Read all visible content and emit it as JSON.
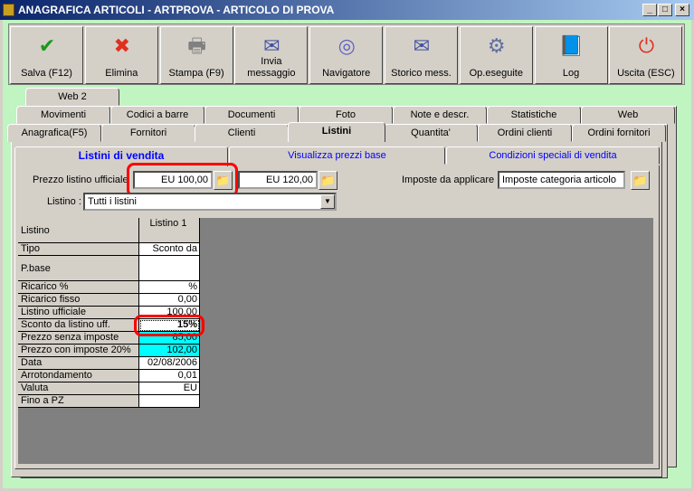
{
  "window": {
    "title": "ANAGRAFICA ARTICOLI - ARTPROVA - ARTICOLO DI PROVA",
    "minimize": "_",
    "maximize": "□",
    "close": "×"
  },
  "toolbar": [
    {
      "label": "Salva (F12)",
      "icon": "check-icon",
      "glyph": "✔",
      "color": "#1a9a1a"
    },
    {
      "label": "Elimina",
      "icon": "delete-x-icon",
      "glyph": "✖",
      "color": "#e03020"
    },
    {
      "label": "Stampa (F9)",
      "icon": "printer-icon",
      "glyph": "🖶",
      "color": "#808080"
    },
    {
      "label": "Invia messaggio",
      "icon": "envelope-pen-icon",
      "glyph": "✉",
      "color": "#4050a0"
    },
    {
      "label": "Navigatore",
      "icon": "compass-icon",
      "glyph": "◎",
      "color": "#6060c0"
    },
    {
      "label": "Storico mess.",
      "icon": "envelope-search-icon",
      "glyph": "✉",
      "color": "#4050a0"
    },
    {
      "label": "Op.eseguite",
      "icon": "gears-search-icon",
      "glyph": "⚙",
      "color": "#6070a0"
    },
    {
      "label": "Log",
      "icon": "book-search-icon",
      "glyph": "📘",
      "color": "#2040c0"
    },
    {
      "label": "Uscita (ESC)",
      "icon": "power-icon",
      "glyph": "⏻",
      "color": "#e03020"
    }
  ],
  "tabs": {
    "row1": [
      "Web 2"
    ],
    "row2": [
      "Movimenti",
      "Codici a barre",
      "Documenti",
      "Foto",
      "Note e descr.",
      "Statistiche",
      "Web"
    ],
    "row3": [
      "Anagrafica(F5)",
      "Fornitori",
      "Clienti",
      "Listini",
      "Quantita'",
      "Ordini clienti",
      "Ordini fornitori"
    ],
    "active": "Listini"
  },
  "subtabs": [
    "Listini di vendita",
    "Visualizza prezzi base",
    "Condizioni speciali di vendita"
  ],
  "form": {
    "prezzo_label": "Prezzo listino ufficiale",
    "prezzo1": "EU 100,00",
    "prezzo2": "EU 120,00",
    "imposte_label": "Imposte da applicare :",
    "imposte_value": "Imposte categoria articolo",
    "listino_label": "Listino :",
    "listino_value": "Tutti i listini"
  },
  "grid": {
    "header_label": "Listino",
    "column": "Listino 1",
    "rows": [
      {
        "label": "Tipo",
        "value": "Sconto da"
      },
      {
        "label": "P.base",
        "value": ""
      },
      {
        "label": "Ricarico %",
        "value": "%"
      },
      {
        "label": "Ricarico fisso",
        "value": "0,00"
      },
      {
        "label": "Listino ufficiale",
        "value": "100,00"
      },
      {
        "label": "Sconto da listino uff.",
        "value": "15%"
      },
      {
        "label": "Prezzo senza imposte",
        "value": "85,00"
      },
      {
        "label": "Prezzo con imposte 20%",
        "value": "102,00"
      },
      {
        "label": "Data",
        "value": "02/08/2006"
      },
      {
        "label": "Arrotondamento",
        "value": "0,01"
      },
      {
        "label": "Valuta",
        "value": "EU"
      },
      {
        "label": "Fino a PZ",
        "value": ""
      }
    ]
  },
  "colors": {
    "highlight": "#00ffff",
    "annotation": "#ff0000",
    "background": "#c0f4c0"
  }
}
